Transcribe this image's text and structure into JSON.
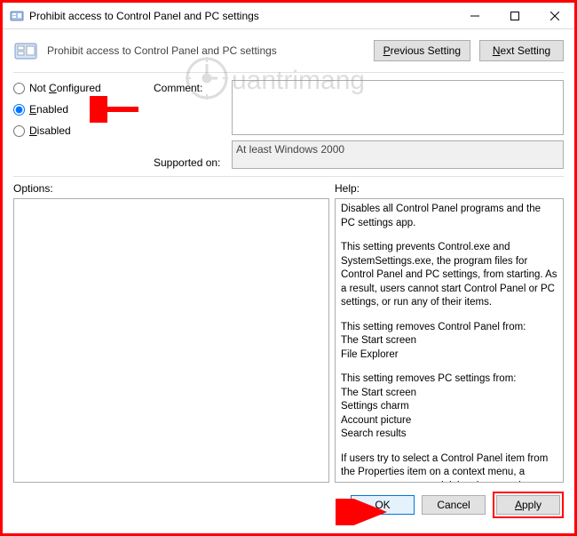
{
  "window": {
    "title": "Prohibit access to Control Panel and PC settings"
  },
  "header": {
    "policy_title": "Prohibit access to Control Panel and PC settings",
    "prev_prefix": "P",
    "prev_rest": "revious Setting",
    "next_prefix": "N",
    "next_rest": "ext Setting"
  },
  "radios": {
    "not_configured_prefix": "Not ",
    "not_configured_ul": "C",
    "not_configured_rest": "onfigured",
    "enabled_ul": "E",
    "enabled_rest": "nabled",
    "disabled_ul": "D",
    "disabled_rest": "isabled"
  },
  "labels": {
    "comment": "Comment:",
    "supported_on": "Supported on:",
    "options": "Options:",
    "help": "Help:"
  },
  "fields": {
    "comment_value": "",
    "supported_on_value": "At least Windows 2000"
  },
  "help": {
    "p1": "Disables all Control Panel programs and the PC settings app.",
    "p2": "This setting prevents Control.exe and SystemSettings.exe, the program files for Control Panel and PC settings, from starting. As a result, users cannot start Control Panel or PC settings, or run any of their items.",
    "p3": "This setting removes Control Panel from:\nThe Start screen\nFile Explorer",
    "p4": "This setting removes PC settings from:\nThe Start screen\nSettings charm\nAccount picture\nSearch results",
    "p5": "If users try to select a Control Panel item from the Properties item on a context menu, a message appears explaining that a setting prevents the action."
  },
  "footer": {
    "ok": "OK",
    "cancel": "Cancel",
    "apply_ul": "A",
    "apply_rest": "pply"
  },
  "watermark": {
    "text": "uantrimang"
  }
}
